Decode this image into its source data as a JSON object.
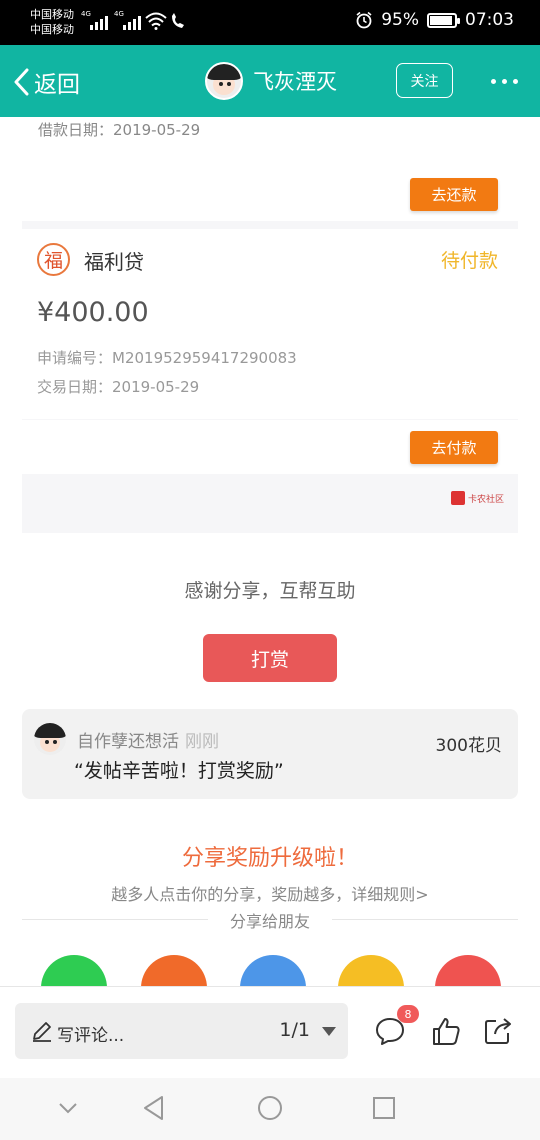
{
  "status_bar": {
    "carrier_1": "中国移动",
    "carrier_2": "中国移动",
    "network_1": "4G",
    "network_2": "4G",
    "battery": "95%",
    "time": "07:03"
  },
  "header": {
    "back_label": "返回",
    "username": "飞灰湮灭",
    "follow_label": "关注",
    "accent_color": "#11b5a2"
  },
  "screenshot": {
    "top_card": {
      "loan_date": "借款日期：2019-05-29",
      "action_label": "去还款"
    },
    "main_card": {
      "logo_char": "福",
      "loan_name": "福利贷",
      "status": "待付款",
      "amount": "¥400.00",
      "apply_no": "申请编号：M201952959417290083",
      "trade_date": "交易日期：2019-05-29",
      "action_label": "去付款"
    },
    "watermark": "卡农社区"
  },
  "thanks": {
    "text": "感谢分享，互帮互助",
    "reward_label": "打赏"
  },
  "comment": {
    "user": "自作孽还想活",
    "time": "刚刚",
    "amount": "300花贝",
    "text": "“发帖辛苦啦！打赏奖励”"
  },
  "share": {
    "title": "分享奖励升级啦！",
    "desc": "越多人点击你的分享，奖励越多，详细规则>",
    "friends_label": "分享给朋友",
    "icons": [
      {
        "name": "wechat-icon",
        "color": "#2ecc52"
      },
      {
        "name": "moments-icon",
        "color": "#f06a2a"
      },
      {
        "name": "qq-icon",
        "color": "#4d96e8"
      },
      {
        "name": "qzone-icon",
        "color": "#f5be24"
      },
      {
        "name": "weibo-icon",
        "color": "#ef5350"
      }
    ]
  },
  "bottom_bar": {
    "comment_placeholder": "写评论...",
    "page_indicator": "1/1",
    "comment_count_badge": "8"
  }
}
